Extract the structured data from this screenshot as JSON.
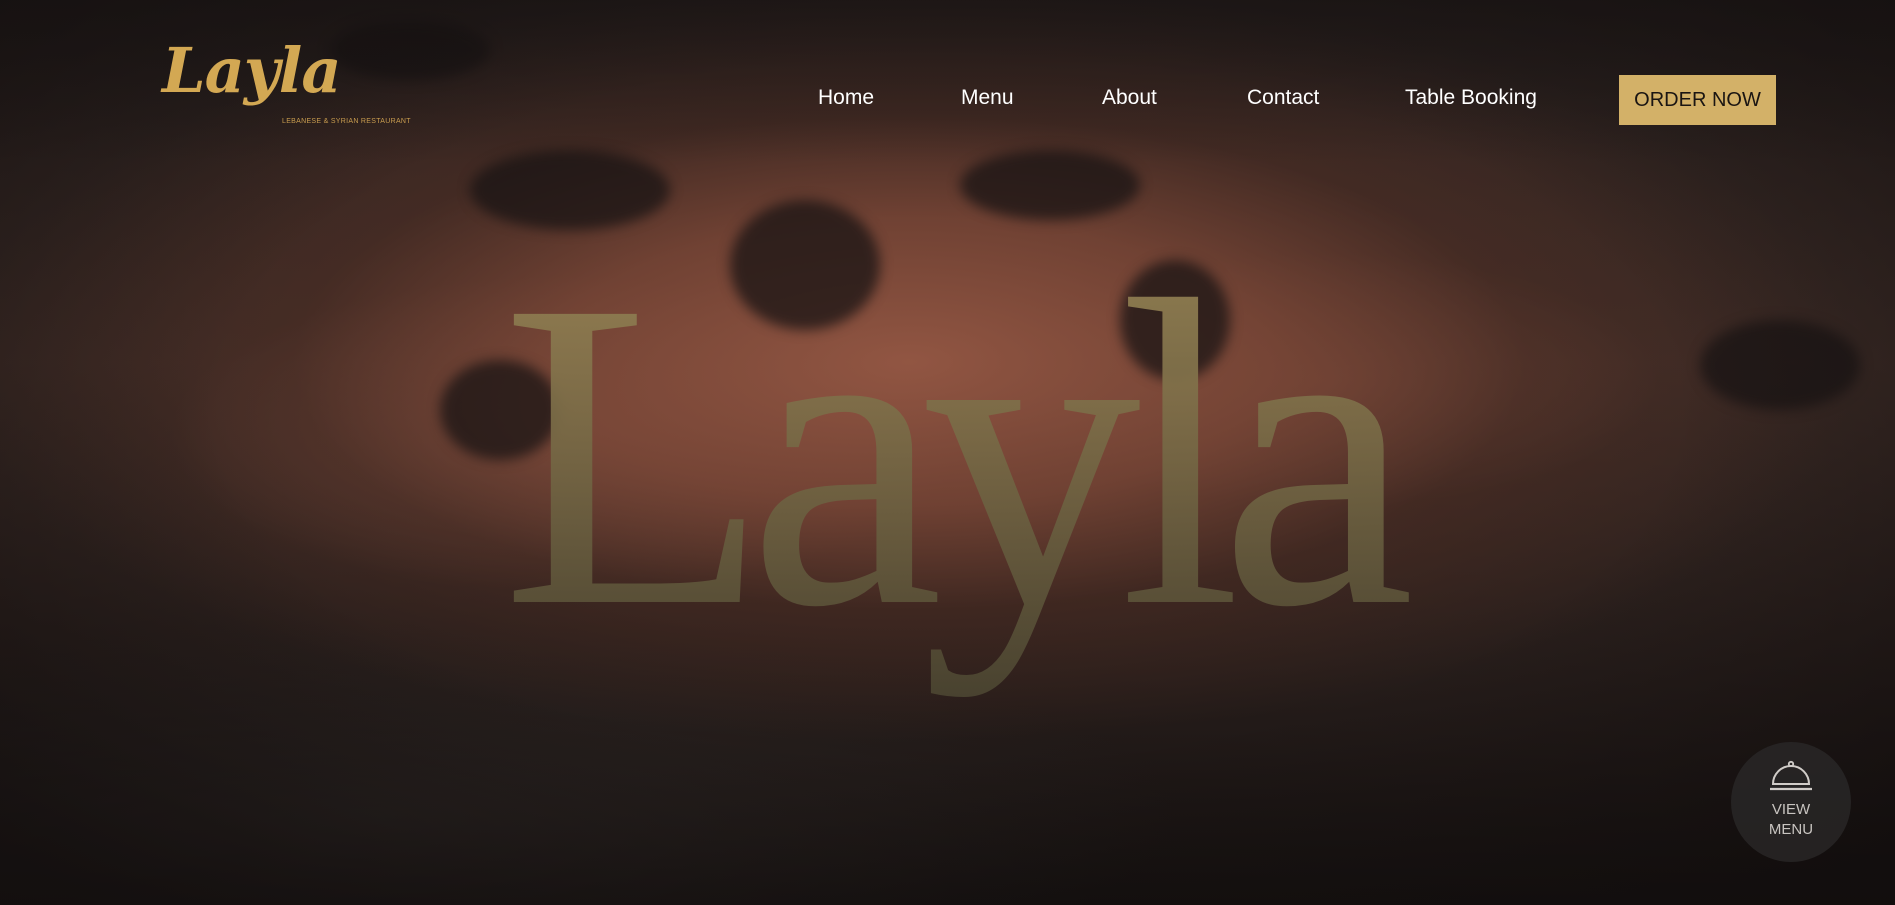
{
  "brand": {
    "logo_text": "Layla",
    "tagline": "LEBANESE & SYRIAN RESTAURANT"
  },
  "nav": {
    "items": [
      {
        "label": "Home"
      },
      {
        "label": "Menu"
      },
      {
        "label": "About"
      },
      {
        "label": "Contact"
      },
      {
        "label": "Table Booking"
      }
    ],
    "order_button": "ORDER NOW"
  },
  "hero": {
    "title": "Layla",
    "background": "grilled-kofta-close-up-image"
  },
  "floating_button": {
    "label_line1": "VIEW",
    "label_line2": "MENU",
    "icon": "cloche-icon"
  },
  "colors": {
    "gold": "#d3a853",
    "button_gold": "#d3b168",
    "title_gold_top": "#9e8a58",
    "title_gold_bottom": "#4b4531"
  }
}
